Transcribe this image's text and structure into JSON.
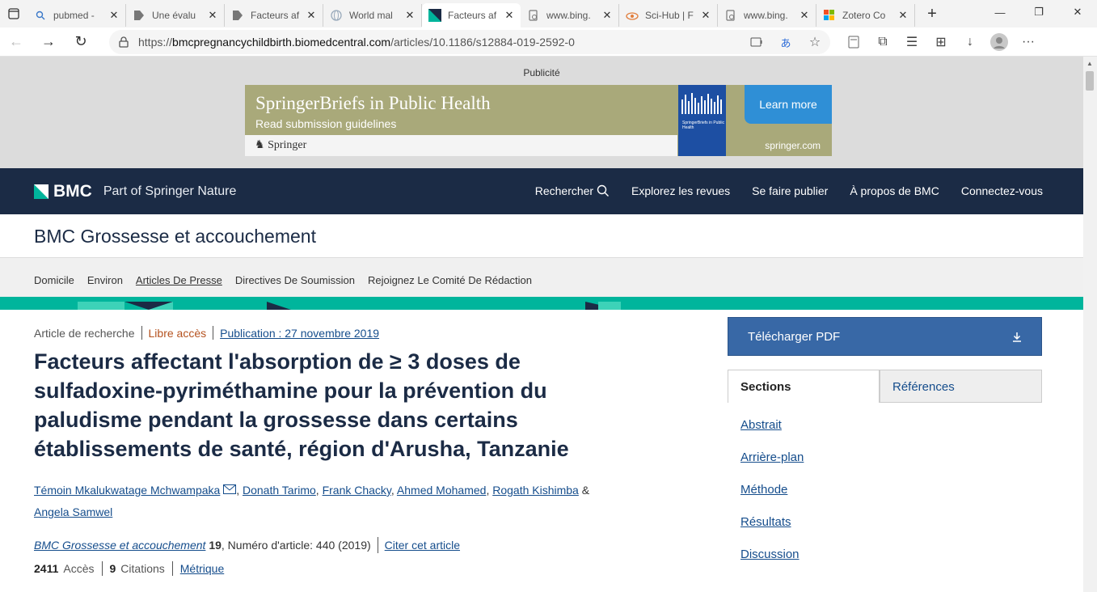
{
  "tabs": [
    {
      "label": "pubmed -",
      "icon": "search-icon"
    },
    {
      "label": "Une évalu",
      "icon": "page-icon"
    },
    {
      "label": "Facteurs af",
      "icon": "page-icon"
    },
    {
      "label": "World mal",
      "icon": "globe-icon"
    },
    {
      "label": "Facteurs af",
      "icon": "bmc-icon"
    },
    {
      "label": "www.bing.",
      "icon": "doc-icon"
    },
    {
      "label": "Sci-Hub | F",
      "icon": "scihub-icon"
    },
    {
      "label": "www.bing.",
      "icon": "doc-icon"
    },
    {
      "label": "Zotero Co",
      "icon": "windows-icon"
    }
  ],
  "address": {
    "host": "bmcpregnancychildbirth.biomedcentral.com",
    "path": "/articles/10.1186/s12884-019-2592-0",
    "prefix": "https://"
  },
  "ad": {
    "label": "Publicité",
    "headline": "SpringerBriefs in Public Health",
    "sub": "Read submission guidelines",
    "brand": "Springer",
    "cta": "Learn more",
    "url": "springer.com",
    "book_title": "SpringerBriefs in Public Health"
  },
  "bmc": {
    "logo": "BMC",
    "tagline": "Part of Springer Nature",
    "nav": [
      "Rechercher",
      "Explorez les revues",
      "Se faire publier",
      "À propos de BMC",
      "Connectez-vous"
    ]
  },
  "journal": {
    "title": "BMC Grossesse et accouchement",
    "subnav": [
      "Domicile",
      "Environ",
      "Articles De Presse",
      "Directives De Soumission",
      "Rejoignez Le Comité De Rédaction"
    ]
  },
  "article": {
    "type": "Article de recherche",
    "access": "Libre accès",
    "published": "Publication : 27 novembre 2019",
    "title": "Facteurs affectant l'absorption de ≥ 3 doses de sulfadoxine-pyriméthamine pour la prévention du paludisme pendant la grossesse dans certains établissements de santé, région d'Arusha, Tanzanie",
    "authors": [
      "Témoin Mkalukwatage Mchwampaka",
      "Donath Tarimo",
      "Frank Chacky",
      "Ahmed Mohamed",
      "Rogath Kishimba",
      "Angela Samwel"
    ],
    "journal_name": "BMC Grossesse et accouchement",
    "volume": "19",
    "article_no": ", Numéro d'article: 440 (2019)",
    "cite": "Citer cet article",
    "accesses": "2411",
    "accesses_label": "Accès",
    "citations": "9",
    "citations_label": "Citations",
    "metrics": "Métrique"
  },
  "sidebar": {
    "pdf": "Télécharger PDF",
    "tab_sections": "Sections",
    "tab_refs": "Références",
    "sections": [
      "Abstrait",
      "Arrière-plan",
      "Méthode",
      "Résultats",
      "Discussion"
    ]
  },
  "colors": {
    "navy": "#1b2b45",
    "teal": "#00b59c",
    "link": "#154d8c",
    "pdf": "#3868a6",
    "oa": "#b5521f"
  }
}
